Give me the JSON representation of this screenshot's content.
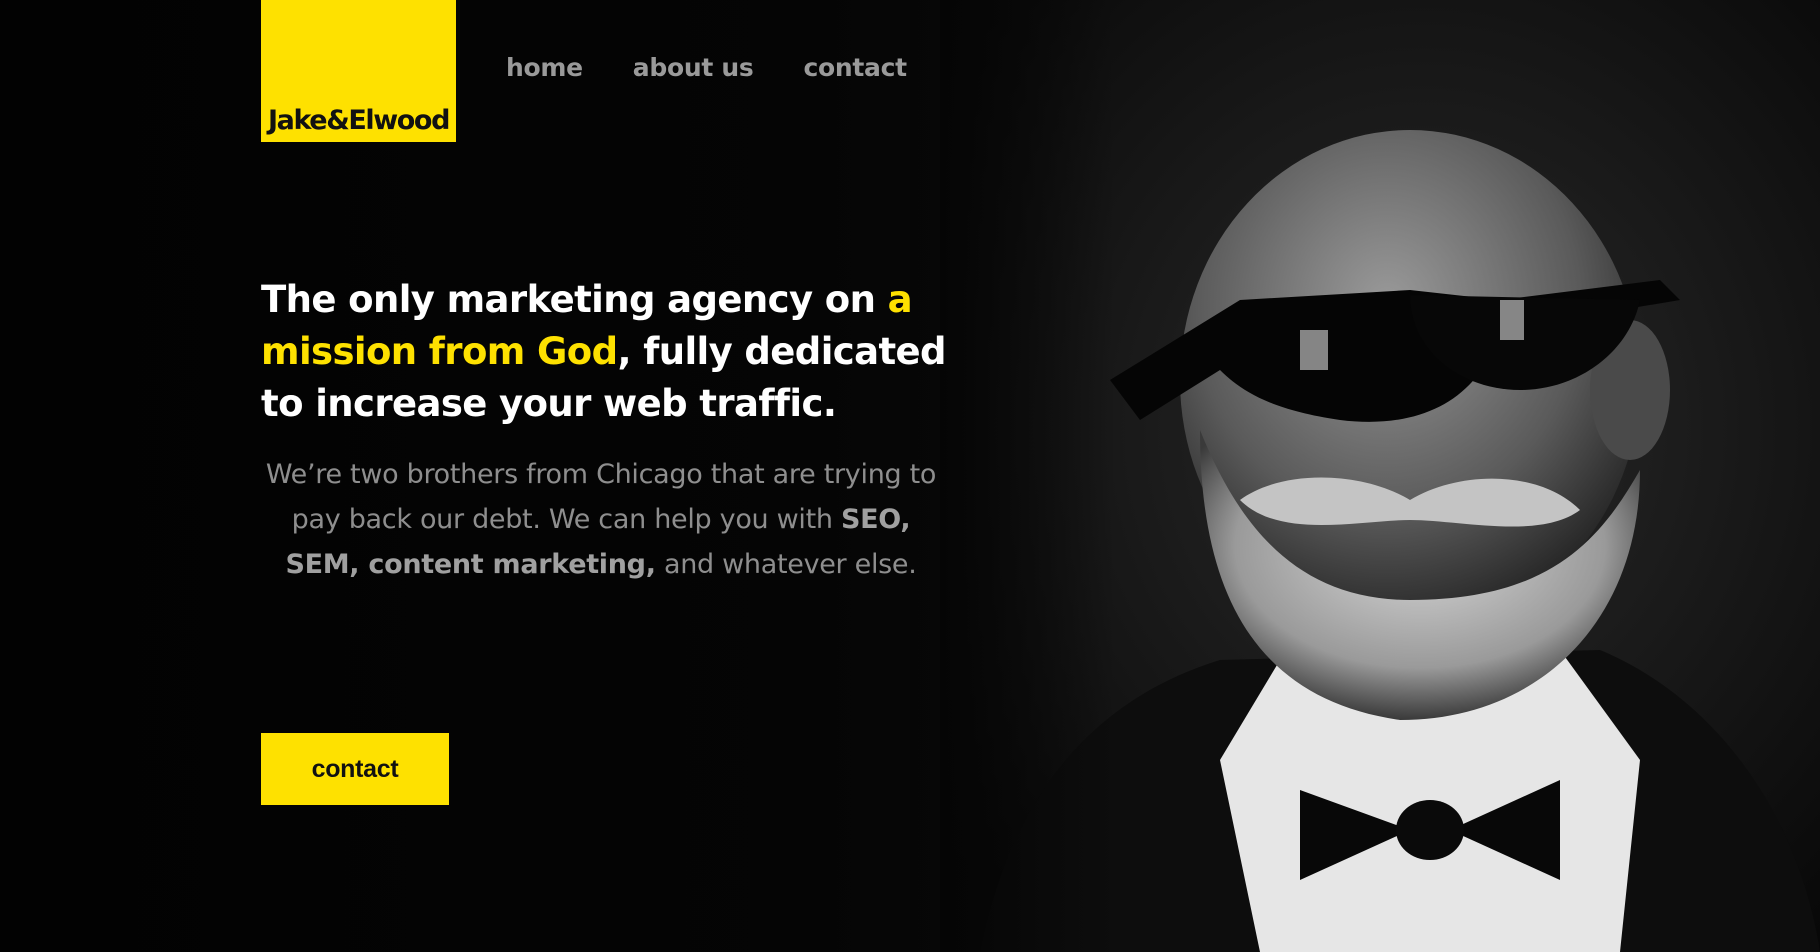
{
  "brand": {
    "logo_text": "Jake&Elwood",
    "accent": "#fee100"
  },
  "nav": {
    "items": [
      "home",
      "about us",
      "contact"
    ]
  },
  "hero": {
    "headline": {
      "part1": "The only marketing agency on ",
      "highlight": "a mission from God",
      "part2": ", fully dedicated to increase your web traffic."
    },
    "sub": {
      "part1": "We’re two brothers from Chicago that are trying to pay back our debt. We can help you with ",
      "strong": "SEO, SEM, content marketing,",
      "part2": " and whatever else."
    },
    "cta_label": "contact",
    "image": "bearded-man-sunglasses-bowtie"
  },
  "colors": {
    "background": "#000000",
    "headline": "#ffffff",
    "nav": "#9a9a9a",
    "subtext": "#8e8e8e"
  }
}
